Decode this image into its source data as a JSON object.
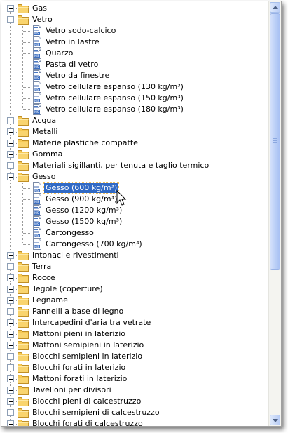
{
  "tree": {
    "items": [
      {
        "label": "Gas",
        "type": "folder",
        "level": 0,
        "expanded": false
      },
      {
        "label": "Vetro",
        "type": "folder",
        "level": 0,
        "expanded": true
      },
      {
        "label": "Vetro sodo-calcico",
        "type": "doc",
        "level": 1
      },
      {
        "label": "Vetro in lastre",
        "type": "doc",
        "level": 1
      },
      {
        "label": "Quarzo",
        "type": "doc",
        "level": 1
      },
      {
        "label": "Pasta di vetro",
        "type": "doc",
        "level": 1
      },
      {
        "label": "Vetro da finestre",
        "type": "doc",
        "level": 1
      },
      {
        "label": "Vetro cellulare espanso (130 kg/m³)",
        "type": "doc",
        "level": 1
      },
      {
        "label": "Vetro cellulare espanso (150 kg/m³)",
        "type": "doc",
        "level": 1
      },
      {
        "label": "Vetro cellulare espanso (180 kg/m³)",
        "type": "doc",
        "level": 1
      },
      {
        "label": "Acqua",
        "type": "folder",
        "level": 0,
        "expanded": false
      },
      {
        "label": "Metalli",
        "type": "folder",
        "level": 0,
        "expanded": false
      },
      {
        "label": "Materie plastiche compatte",
        "type": "folder",
        "level": 0,
        "expanded": false
      },
      {
        "label": "Gomma",
        "type": "folder",
        "level": 0,
        "expanded": false
      },
      {
        "label": "Materiali sigillanti, per tenuta e taglio termico",
        "type": "folder",
        "level": 0,
        "expanded": false
      },
      {
        "label": "Gesso",
        "type": "folder",
        "level": 0,
        "expanded": true
      },
      {
        "label": "Gesso (600 kg/m³)",
        "type": "doc",
        "level": 1,
        "selected": true
      },
      {
        "label": "Gesso (900 kg/m³)",
        "type": "doc",
        "level": 1
      },
      {
        "label": "Gesso (1200 kg/m³)",
        "type": "doc",
        "level": 1
      },
      {
        "label": "Gesso (1500 kg/m³)",
        "type": "doc",
        "level": 1
      },
      {
        "label": "Cartongesso",
        "type": "doc",
        "level": 1
      },
      {
        "label": "Cartongesso (700 kg/m³)",
        "type": "doc",
        "level": 1
      },
      {
        "label": "Intonaci e rivestimenti",
        "type": "folder",
        "level": 0,
        "expanded": false
      },
      {
        "label": "Terra",
        "type": "folder",
        "level": 0,
        "expanded": false
      },
      {
        "label": "Rocce",
        "type": "folder",
        "level": 0,
        "expanded": false
      },
      {
        "label": "Tegole (coperture)",
        "type": "folder",
        "level": 0,
        "expanded": false
      },
      {
        "label": "Legname",
        "type": "folder",
        "level": 0,
        "expanded": false
      },
      {
        "label": "Pannelli a base di legno",
        "type": "folder",
        "level": 0,
        "expanded": false
      },
      {
        "label": "Intercapedini d'aria tra vetrate",
        "type": "folder",
        "level": 0,
        "expanded": false
      },
      {
        "label": "Mattoni pieni in laterizio",
        "type": "folder",
        "level": 0,
        "expanded": false
      },
      {
        "label": "Mattoni semipieni in laterizio",
        "type": "folder",
        "level": 0,
        "expanded": false
      },
      {
        "label": "Blocchi semipieni in laterizio",
        "type": "folder",
        "level": 0,
        "expanded": false
      },
      {
        "label": "Blocchi forati in laterizio",
        "type": "folder",
        "level": 0,
        "expanded": false
      },
      {
        "label": "Mattoni forati in laterizio",
        "type": "folder",
        "level": 0,
        "expanded": false
      },
      {
        "label": "Tavelloni per divisori",
        "type": "folder",
        "level": 0,
        "expanded": false
      },
      {
        "label": "Blocchi pieni di calcestruzzo",
        "type": "folder",
        "level": 0,
        "expanded": false
      },
      {
        "label": "Blocchi semipieni di calcestruzzo",
        "type": "folder",
        "level": 0,
        "expanded": false
      },
      {
        "label": "Blocchi forati di calcestruzzo",
        "type": "folder",
        "level": 0,
        "expanded": false
      }
    ]
  },
  "icons": {
    "folder": "folder-icon",
    "doc": "material-document-icon",
    "expand": "plus-expander-icon",
    "collapse": "minus-expander-icon",
    "cursor": "mouse-pointer-icon"
  },
  "colors": {
    "selection": "#316ac5",
    "folder": "#f6c955",
    "scrollbar": "#b8cdf6"
  }
}
